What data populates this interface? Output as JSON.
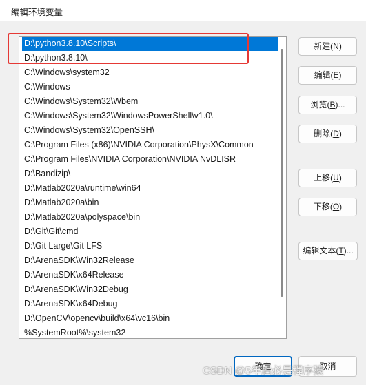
{
  "window": {
    "title": "编辑环境变量"
  },
  "path_list": {
    "selected_index": 0,
    "items": [
      "D:\\python3.8.10\\Scripts\\",
      "D:\\python3.8.10\\",
      "C:\\Windows\\system32",
      "C:\\Windows",
      "C:\\Windows\\System32\\Wbem",
      "C:\\Windows\\System32\\WindowsPowerShell\\v1.0\\",
      "C:\\Windows\\System32\\OpenSSH\\",
      "C:\\Program Files (x86)\\NVIDIA Corporation\\PhysX\\Common",
      "C:\\Program Files\\NVIDIA Corporation\\NVIDIA NvDLISR",
      "D:\\Bandizip\\",
      "D:\\Matlab2020a\\runtime\\win64",
      "D:\\Matlab2020a\\bin",
      "D:\\Matlab2020a\\polyspace\\bin",
      "D:\\Git\\Git\\cmd",
      "D:\\Git Large\\Git LFS",
      "D:\\ArenaSDK\\Win32Release",
      "D:\\ArenaSDK\\x64Release",
      "D:\\ArenaSDK\\Win32Debug",
      "D:\\ArenaSDK\\x64Debug",
      "D:\\OpenCV\\opencv\\build\\x64\\vc16\\bin",
      "%SystemRoot%\\system32"
    ]
  },
  "buttons": {
    "new_label": "新建(",
    "new_key": "N",
    "new_end": ")",
    "edit_label": "编辑(",
    "edit_key": "E",
    "edit_end": ")",
    "browse_label": "浏览(",
    "browse_key": "B",
    "browse_end": ")...",
    "delete_label": "删除(",
    "delete_key": "D",
    "delete_end": ")",
    "move_up_label": "上移(",
    "move_up_key": "U",
    "move_up_end": ")",
    "move_down_label": "下移(",
    "move_down_key": "O",
    "move_down_end": ")",
    "edit_text_label": "编辑文本(",
    "edit_text_key": "T",
    "edit_text_end": ")..."
  },
  "footer": {
    "ok_label": "确定",
    "cancel_label": "取消"
  },
  "watermark": {
    "text": "CSDN @5年后必是程序猿"
  },
  "colors": {
    "selection": "#0078d7",
    "highlight_box": "#e53935"
  }
}
